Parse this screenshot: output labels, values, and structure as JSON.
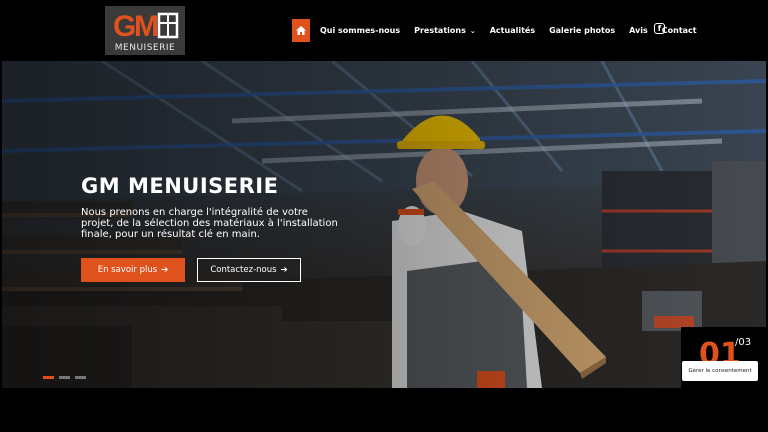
{
  "brand": {
    "logo_text": "MENUISERIE",
    "accent_color": "#e0521d"
  },
  "nav": {
    "home_icon": "home-icon",
    "items": [
      {
        "label": "Qui sommes-nous"
      },
      {
        "label": "Prestations"
      },
      {
        "label": "Actualités"
      },
      {
        "label": "Galerie photos"
      },
      {
        "label": "Avis"
      },
      {
        "label": "Contact"
      }
    ],
    "facebook_icon": "facebook-icon"
  },
  "hero": {
    "title": "GM MENUISERIE",
    "description": "Nous prenons en charge l'intégralité de votre projet, de la sélection des matériaux à l'installation finale, pour un résultat clé en main.",
    "primary_cta": "En savoir plus",
    "secondary_cta": "Contactez-nous",
    "slide_current": "01",
    "slide_total": "/03",
    "slides_count": 3,
    "active_slide": 1
  },
  "consent": {
    "label": "Gérer le consentement"
  }
}
